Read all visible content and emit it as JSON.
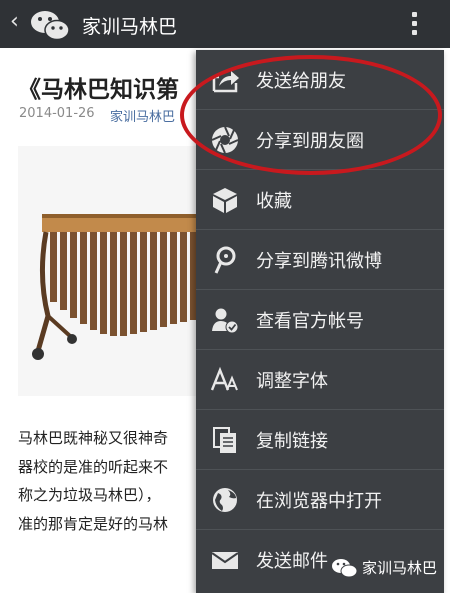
{
  "header": {
    "back_icon": "chevron-left-icon",
    "logo_icon": "wechat-logo-icon",
    "title": "家训马林巴",
    "more_icon": "vertical-dots-icon"
  },
  "article": {
    "title": "《马林巴知识第",
    "date": "2014-01-26",
    "author": "家训马林巴",
    "image_alt": "marimba",
    "paragraph_lines": [
      "马林巴既神秘又很神奇",
      "器校的是准的听起来不",
      "称之为垃圾马林巴），",
      "准的那肯定是好的马林"
    ]
  },
  "menu": {
    "items": [
      {
        "label": "发送给朋友",
        "icon": "share-to-friend-icon"
      },
      {
        "label": "分享到朋友圈",
        "icon": "moments-icon"
      },
      {
        "label": "收藏",
        "icon": "favorite-cube-icon"
      },
      {
        "label": "分享到腾讯微博",
        "icon": "tencent-weibo-icon"
      },
      {
        "label": "查看官方帐号",
        "icon": "official-account-icon"
      },
      {
        "label": "调整字体",
        "icon": "font-size-icon"
      },
      {
        "label": "复制链接",
        "icon": "copy-link-icon"
      },
      {
        "label": "在浏览器中打开",
        "icon": "globe-icon"
      },
      {
        "label": "发送邮件",
        "icon": "mail-icon"
      }
    ]
  },
  "annotation": {
    "highlight_color": "#c8191e"
  },
  "watermark": {
    "icon": "wechat-logo-icon",
    "text": "家训马林巴"
  },
  "colors": {
    "topbar": "#2f3236",
    "menu_bg": "#3c3f43",
    "link": "#4a6ea0"
  }
}
